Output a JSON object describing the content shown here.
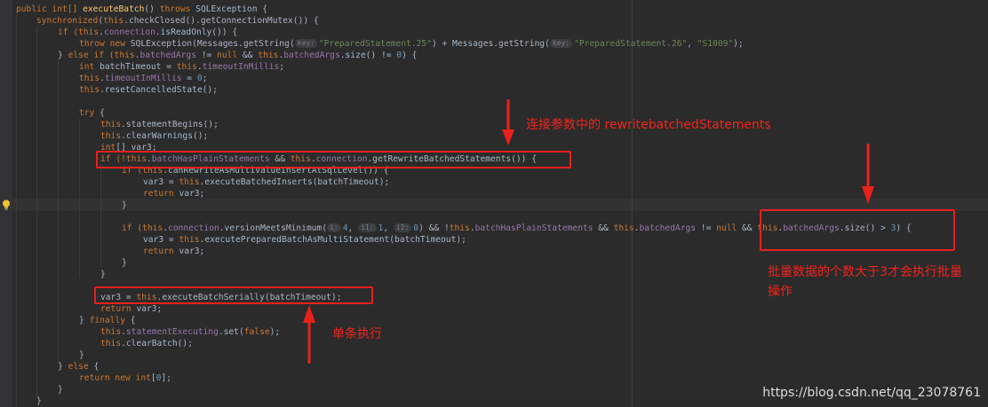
{
  "code": {
    "l01": {
      "t1": "public int[] ",
      "t2": "executeBatch",
      "t3": "() ",
      "t4": "throws",
      "t5": " SQLException {"
    },
    "l02": {
      "t1": "synchronized",
      "t2": "(",
      "t3": "this",
      "t4": ".checkClosed().getConnectionMutex()) {"
    },
    "l03": {
      "t1": "if (",
      "t2": "this",
      "t3": ".",
      "t4": "connection",
      "t5": ".isReadOnly()) {"
    },
    "l04": {
      "t1": "throw new ",
      "t2": "SQLException(Messages.getString(",
      "h1": "key:",
      "t3": "\"PreparedStatement.25\"",
      "t4": ") + Messages.getString(",
      "h2": "key:",
      "t5": "\"PreparedStatement.26\"",
      "t6": ", ",
      "t7": "\"S1009\"",
      "t8": ");"
    },
    "l05": {
      "t1": "} ",
      "t2": "else if (",
      "t3": "this",
      "t4": ".",
      "t5": "batchedArgs",
      "t6": " != ",
      "t7": "null",
      "t8": " && ",
      "t9": "this",
      "t10": ".",
      "t11": "batchedArgs",
      "t12": ".size() != ",
      "t13": "0",
      "t14": ") {"
    },
    "l06": {
      "t1": "int ",
      "t2": "batchTimeout = ",
      "t3": "this",
      "t4": ".",
      "t5": "timeoutInMillis",
      "t6": ";"
    },
    "l07": {
      "t1": "this",
      "t2": ".",
      "t3": "timeoutInMillis",
      "t4": " = ",
      "t5": "0",
      "t6": ";"
    },
    "l08": {
      "t1": "this",
      "t2": ".resetCancelledState();"
    },
    "l09": {
      "t1": "try",
      "t2": " {"
    },
    "l10": {
      "t1": "this",
      "t2": ".statementBegins();"
    },
    "l11": {
      "t1": "this",
      "t2": ".clearWarnings();"
    },
    "l12": {
      "t1": "int",
      "t2": "[] var3;"
    },
    "l13": {
      "t1": "if (!",
      "t2": "this",
      "t3": ".",
      "t4": "batchHasPlainStatements",
      "t5": " && ",
      "t6": "this",
      "t7": ".",
      "t8": "connection",
      "t9": ".getRewriteBatchedStatements()) {"
    },
    "l14": {
      "t1": "if (",
      "t2": "this",
      "t3": ".canRewriteAsMultiValueInsertAtSqlLevel()) {"
    },
    "l15": {
      "t1": "var3 = ",
      "t2": "this",
      "t3": ".executeBatchedInserts(batchTimeout);"
    },
    "l16": {
      "t1": "return ",
      "t2": "var3;"
    },
    "l17": {
      "t1": "}"
    },
    "l18": {
      "t1": "if (",
      "t2": "this",
      "t3": ".",
      "t4": "connection",
      "t5": ".versionMeetsMinimum(",
      "h1": "i:",
      "t6": "4",
      "t7": ", ",
      "h2": "i1:",
      "t8": "1",
      "t9": ", ",
      "h3": "i2:",
      "t10": "0",
      "t11": ") && !",
      "t12": "this",
      "t13": ".",
      "t14": "batchHasPlainStatements",
      "t15": " && ",
      "t16": "this",
      "t17": ".",
      "t18": "batchedArgs",
      "t19": " != ",
      "t20": "null",
      "t21": " && ",
      "t22": "this",
      "t23": ".",
      "t24": "batchedArgs",
      "t25": ".size() > ",
      "t26": "3",
      "t27": ") {"
    },
    "l19": {
      "t1": "var3 = ",
      "t2": "this",
      "t3": ".executePreparedBatchAsMultiStatement(batchTimeout);"
    },
    "l20": {
      "t1": "return ",
      "t2": "var3;"
    },
    "l21": {
      "t1": "}"
    },
    "l22": {
      "t1": "var3 = ",
      "t2": "this",
      "t3": ".executeBatchSerially(batchTimeout);"
    },
    "l23": {
      "t1": "return ",
      "t2": "var3;"
    },
    "l24": {
      "t1": "} ",
      "t2": "finally",
      "t3": " {"
    },
    "l25": {
      "t1": "this",
      "t2": ".",
      "t3": "statementExecuting",
      "t4": ".set(",
      "t5": "false",
      "t6": ");"
    },
    "l26": {
      "t1": "this",
      "t2": ".clearBatch();"
    },
    "l27": {
      "t1": "}"
    },
    "l28": {
      "t1": "} ",
      "t2": "else",
      "t3": " {"
    },
    "l29": {
      "t1": "return new ",
      "t2": "int",
      "t3": "[",
      "t4": "0",
      "t5": "];"
    },
    "l30": {
      "t1": "}"
    },
    "l31": {
      "t1": "}"
    }
  },
  "annotations": {
    "rewrite": "连接参数中的 rewritebatchedStatements",
    "batch_size": "批量数据的个数大于3才会执行批量操作",
    "single": "单条执行"
  },
  "watermark": "https://blog.csdn.net/qq_23078761",
  "colors": {
    "background": "#2b2b2b",
    "keyword": "#cc7832",
    "field": "#9876aa",
    "method_decl": "#ffc66d",
    "string": "#6a8759",
    "number": "#6897bb",
    "annotation_red": "#e8211c"
  },
  "icons": {
    "gutter": "lightbulb-icon"
  }
}
